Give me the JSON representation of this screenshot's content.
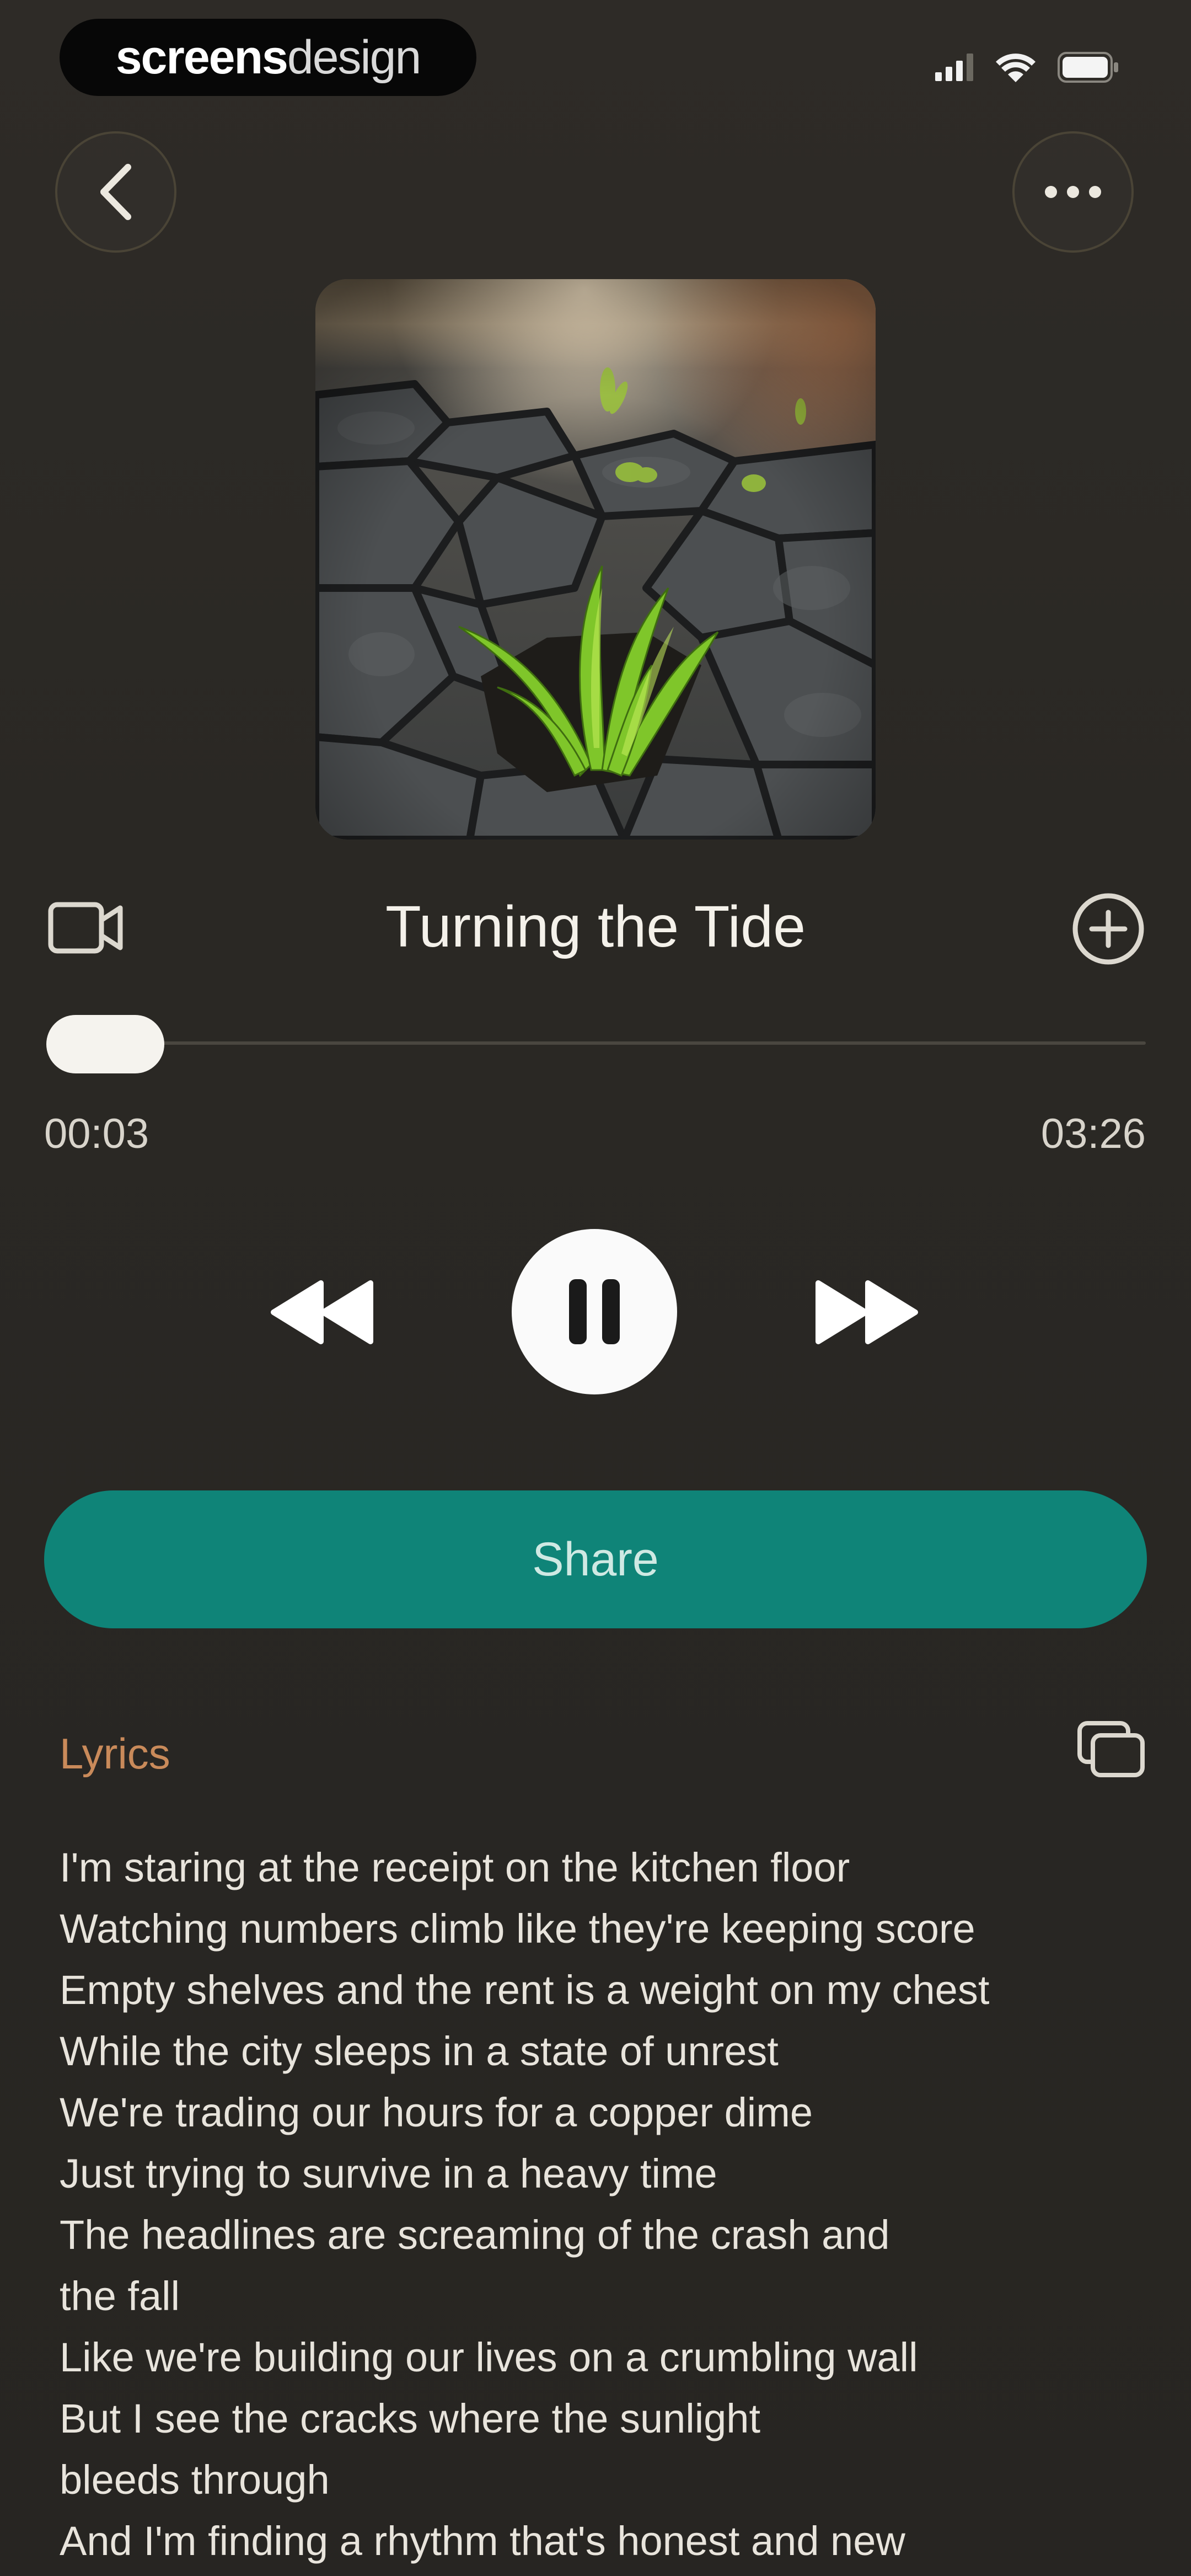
{
  "status_bar": {
    "brand_bold": "screens",
    "brand_light": "design"
  },
  "header": {
    "back_icon": "chevron-left-icon",
    "more_icon": "ellipsis-icon"
  },
  "player": {
    "title": "Turning the Tide",
    "elapsed": "00:03",
    "duration": "03:26",
    "progress": 0.015,
    "is_playing": true
  },
  "share": {
    "label": "Share"
  },
  "lyrics": {
    "heading": "Lyrics",
    "lines": [
      "I'm staring at the receipt on the kitchen floor",
      "Watching numbers climb like they're keeping score",
      "Empty shelves and the rent is a weight on my chest",
      "While the city sleeps in a state of unrest",
      "We're trading our hours for a copper dime",
      "Just trying to survive in a heavy time",
      "The headlines are screaming of the crash and",
      "the fall",
      "Like we're building our lives on a crumbling wall",
      "But I see the cracks where the sunlight",
      "bleeds through",
      "And I'm finding a rhythm that's honest and new"
    ]
  },
  "colors": {
    "background": "#2a2824",
    "accent_share": "#0f8478",
    "lyrics_heading": "#c98a5a",
    "text_primary": "#f4f1ea"
  }
}
